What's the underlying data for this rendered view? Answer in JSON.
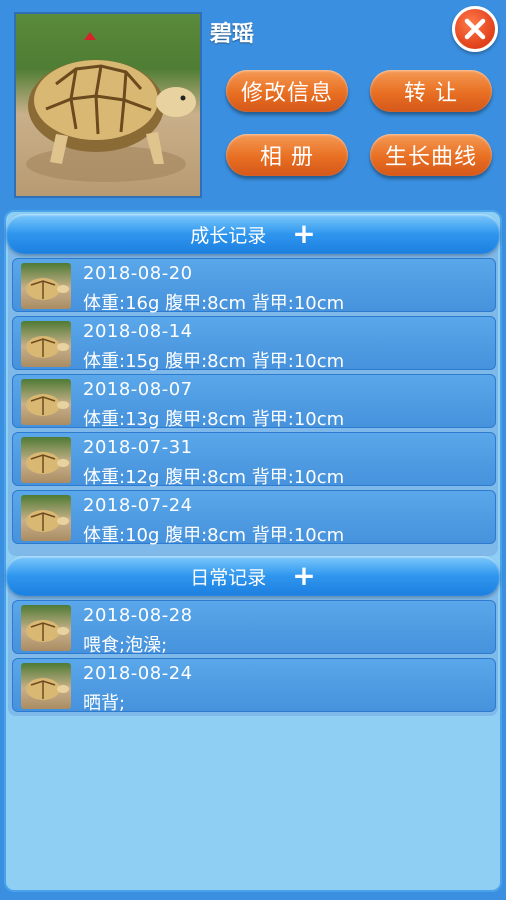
{
  "profile": {
    "name": "碧瑶"
  },
  "buttons": {
    "edit_info": "修改信息",
    "transfer": "转 让",
    "album": "相 册",
    "growth_curve": "生长曲线"
  },
  "growth_section": {
    "title": "成长记录",
    "add_symbol": "+",
    "records": [
      {
        "date": "2018-08-20",
        "detail": "体重:16g  腹甲:8cm  背甲:10cm"
      },
      {
        "date": "2018-08-14",
        "detail": "体重:15g  腹甲:8cm  背甲:10cm"
      },
      {
        "date": "2018-08-07",
        "detail": "体重:13g  腹甲:8cm  背甲:10cm"
      },
      {
        "date": "2018-07-31",
        "detail": "体重:12g  腹甲:8cm  背甲:10cm"
      },
      {
        "date": "2018-07-24",
        "detail": "体重:10g  腹甲:8cm  背甲:10cm"
      }
    ]
  },
  "daily_section": {
    "title": "日常记录",
    "add_symbol": "+",
    "records": [
      {
        "date": "2018-08-28",
        "detail": "喂食;泡澡;"
      },
      {
        "date": "2018-08-24",
        "detail": "晒背;"
      }
    ]
  },
  "icons": {
    "close": "close-icon",
    "add": "plus-icon",
    "thumbnail": "turtle-thumbnail"
  },
  "colors": {
    "background": "#3a8fe0",
    "panel": "#8fcff4",
    "button_orange": "#e86f22",
    "close_red": "#e0401a"
  }
}
